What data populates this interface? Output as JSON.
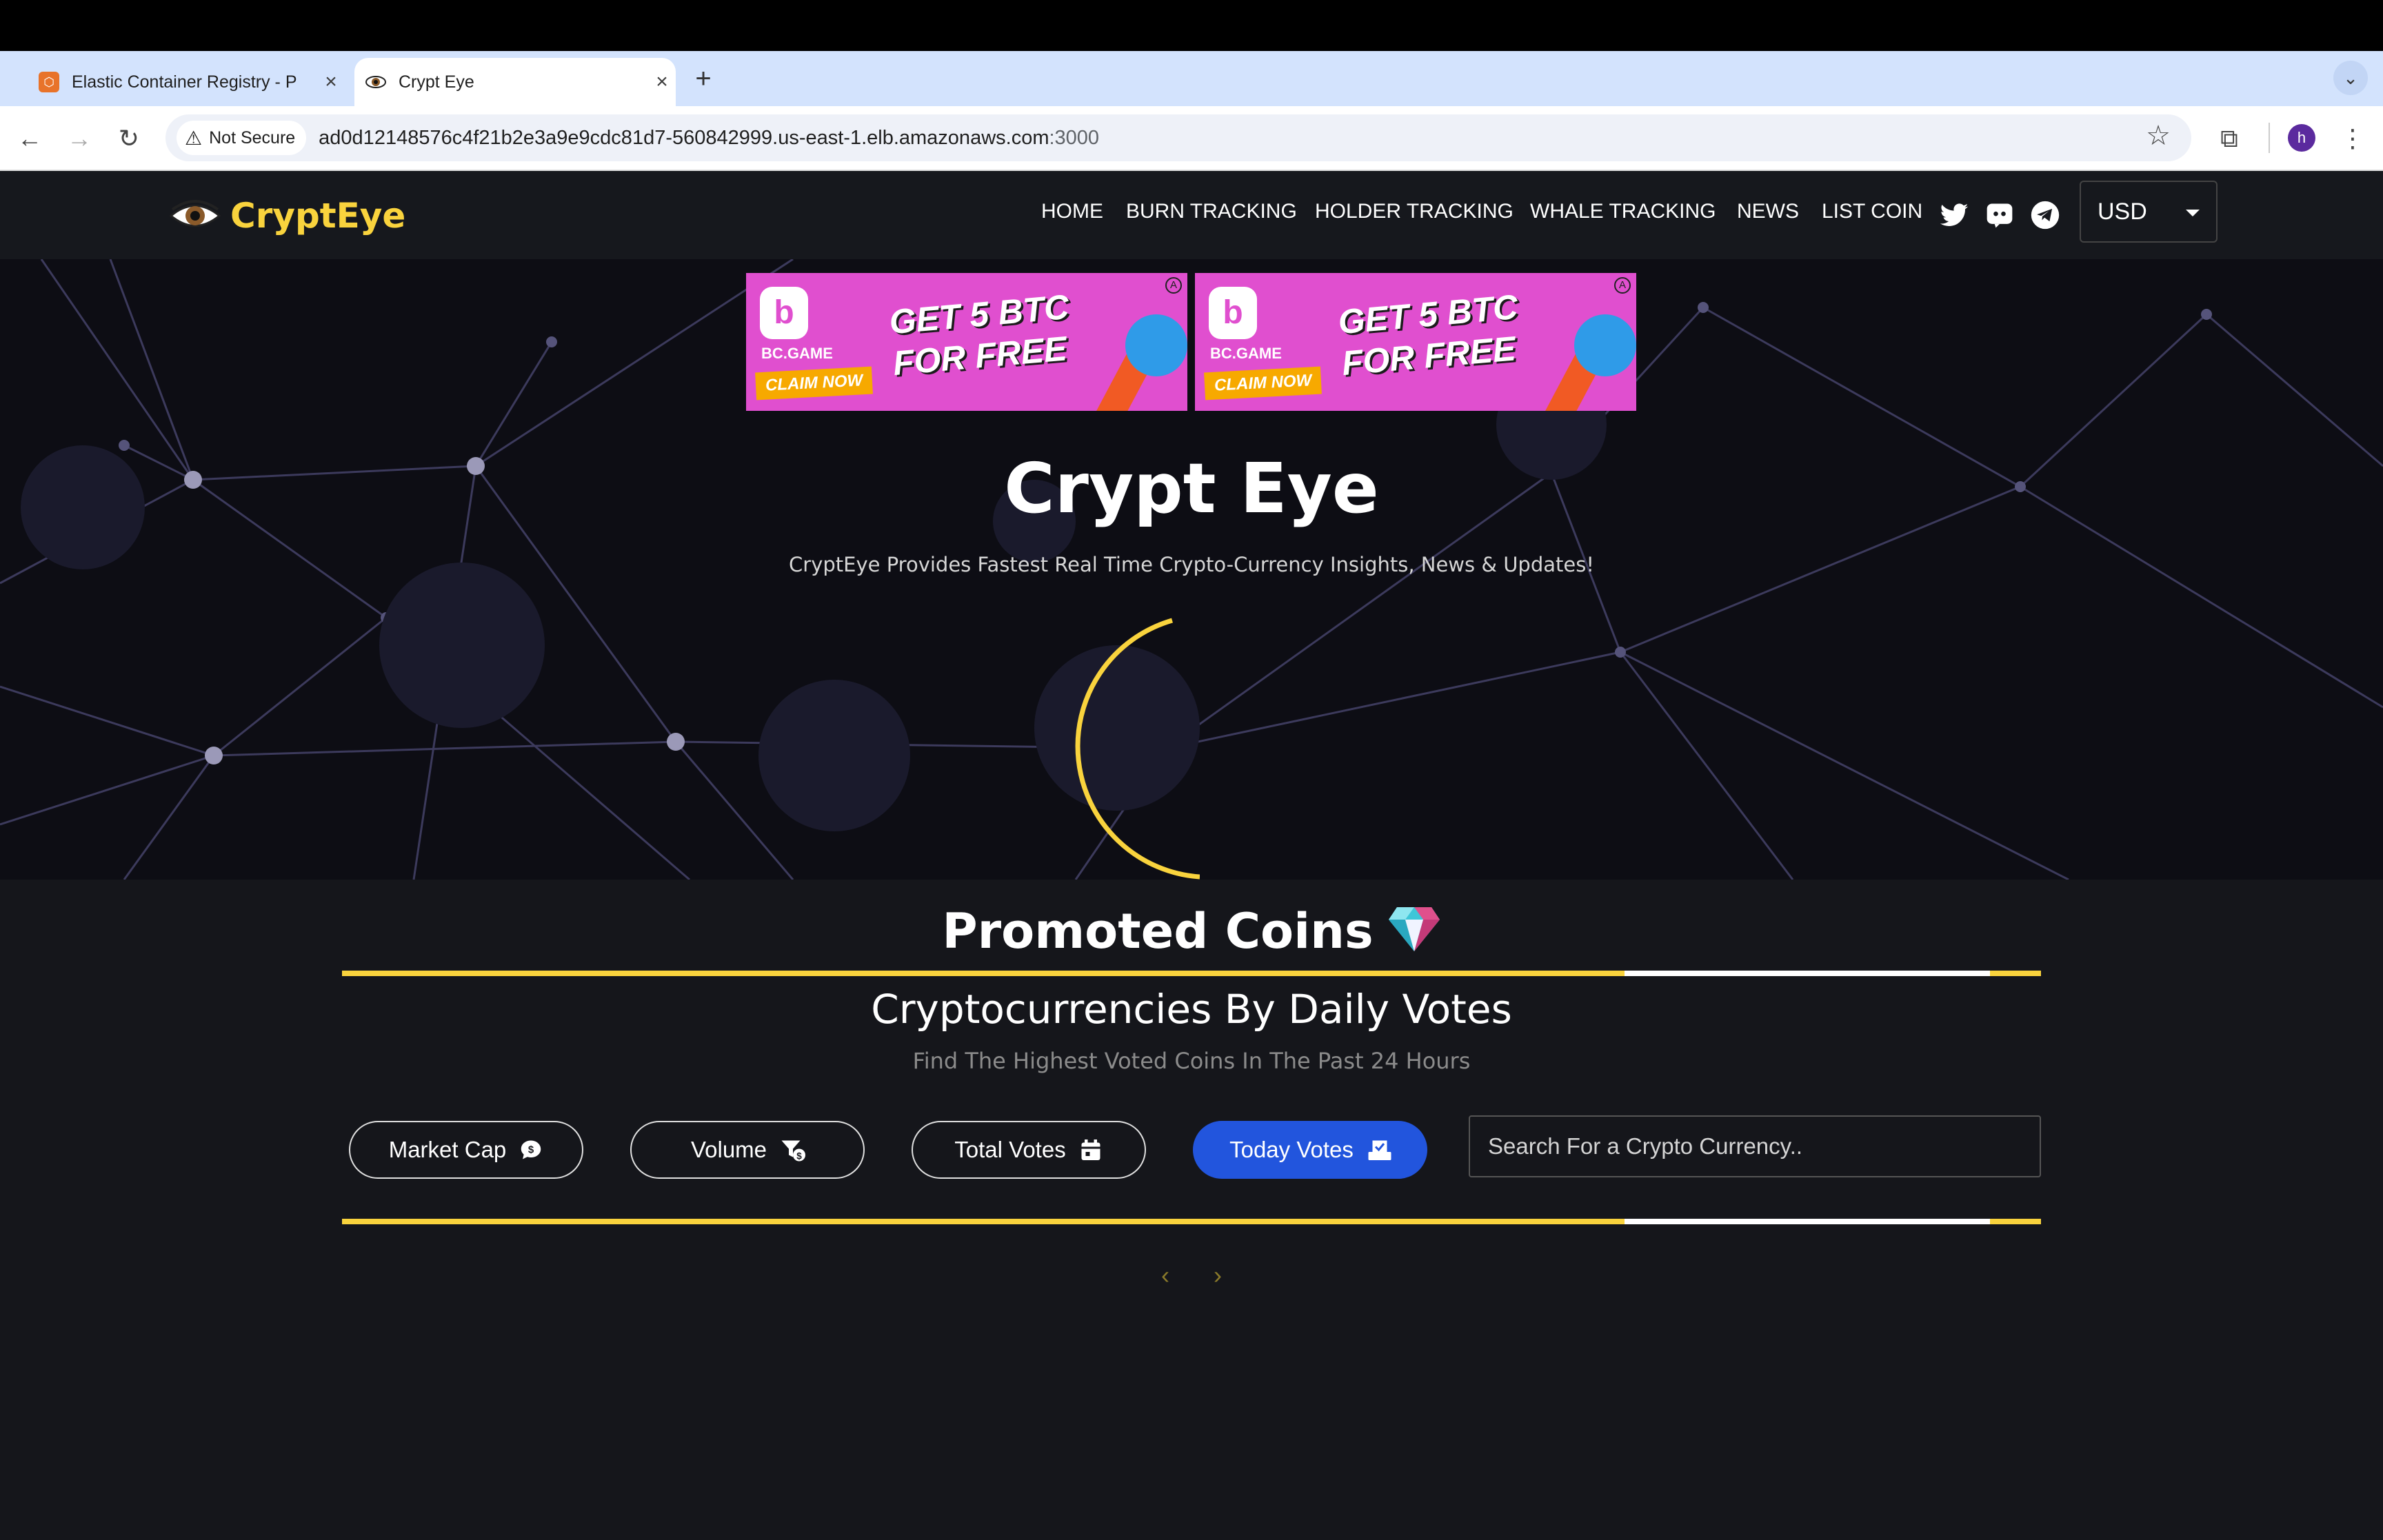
{
  "browser": {
    "tabs": [
      {
        "title": "Elastic Container Registry - P",
        "active": false
      },
      {
        "title": "Crypt Eye",
        "active": true
      }
    ],
    "address": {
      "security_label": "Not Secure",
      "url_host": "ad0d12148576c4f21b2e3a9e9cdc81d7-560842999.us-east-1.elb.amazonaws.com",
      "url_port": ":3000"
    },
    "avatar_letter": "h"
  },
  "site": {
    "logo_text": "CryptEye",
    "nav": [
      "HOME",
      "BURN TRACKING",
      "HOLDER TRACKING",
      "WHALE TRACKING",
      "NEWS",
      "LIST COIN"
    ],
    "currency": "USD",
    "ads": [
      {
        "brand": "BC.GAME",
        "headline_1": "GET 5 BTC",
        "headline_2": "FOR FREE",
        "cta": "CLAIM NOW"
      },
      {
        "brand": "BC.GAME",
        "headline_1": "GET 5 BTC",
        "headline_2": "FOR FREE",
        "cta": "CLAIM NOW"
      }
    ],
    "hero": {
      "title": "Crypt Eye",
      "subtitle": "CryptEye Provides Fastest Real Time Crypto-Currency Insights, News & Updates!"
    },
    "promoted": {
      "title": "Promoted Coins",
      "subtitle": "Cryptocurrencies By Daily Votes",
      "description": "Find The Highest Voted Coins In The Past 24 Hours",
      "filters": [
        "Market Cap",
        "Volume",
        "Total Votes",
        "Today Votes"
      ],
      "active_filter": "Today Votes",
      "search_placeholder": "Search For a Crypto Currency.."
    }
  },
  "colors": {
    "accent_yellow": "#f9d33d",
    "active_blue": "#2255dd",
    "nav_bg": "#16181d",
    "section_bg": "#15161b"
  }
}
